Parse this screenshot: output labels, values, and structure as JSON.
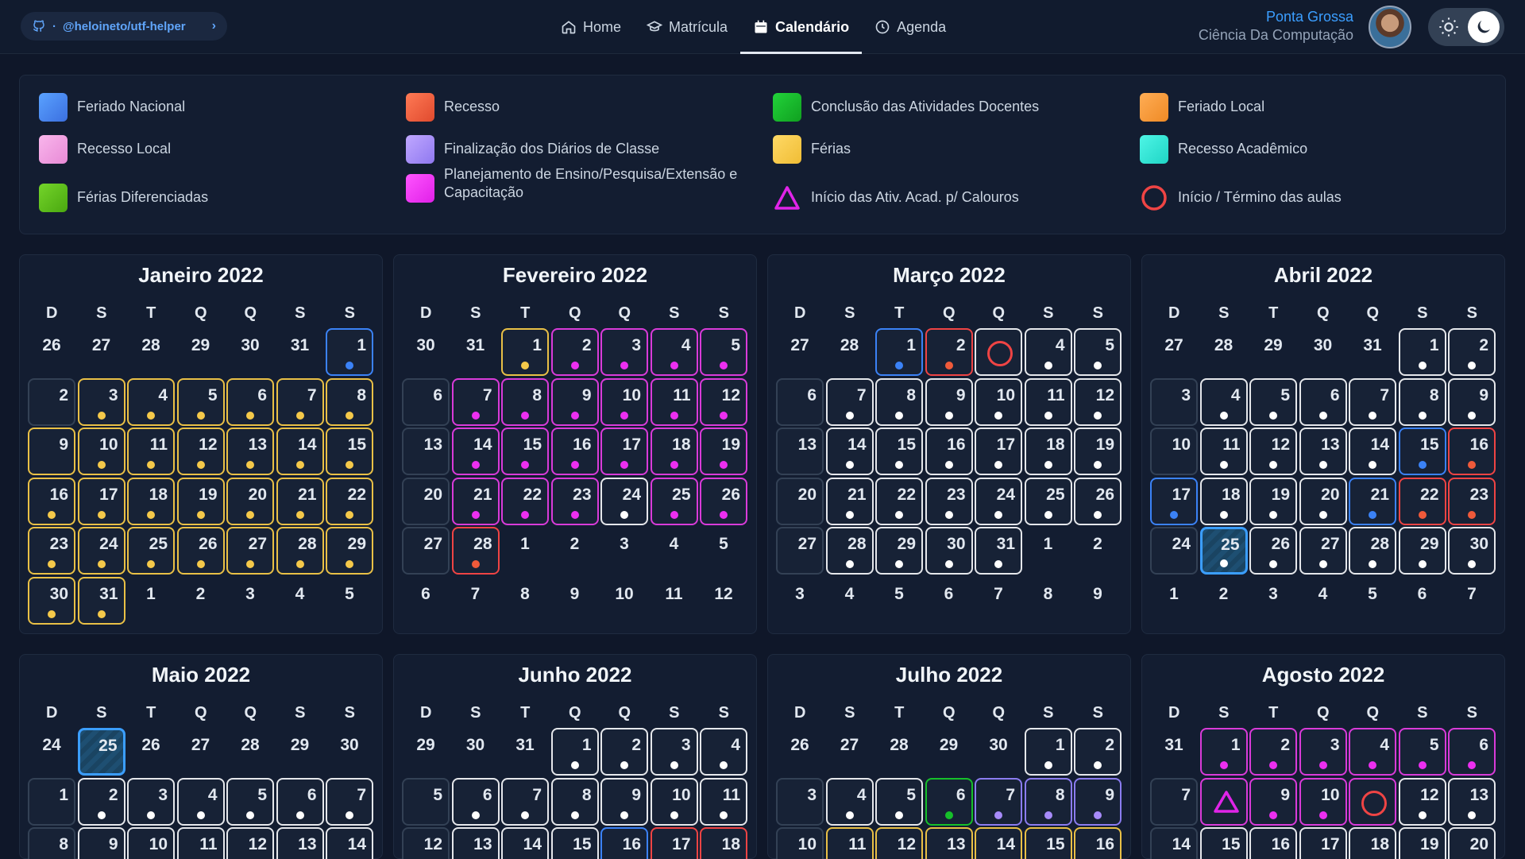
{
  "header": {
    "repo": "@heloineto/utf-helper",
    "nav": [
      {
        "label": "Home",
        "icon": "home-icon"
      },
      {
        "label": "Matrícula",
        "icon": "graduation-cap-icon"
      },
      {
        "label": "Calendário",
        "icon": "calendar-icon",
        "active": true
      },
      {
        "label": "Agenda",
        "icon": "clock-icon"
      }
    ],
    "user_city": "Ponta Grossa",
    "user_course": "Ciência Da Computação"
  },
  "legend": [
    {
      "label": "Feriado Nacional",
      "color": "#3b82f6"
    },
    {
      "label": "Recesso",
      "color": "#f05a3a"
    },
    {
      "label": "Conclusão das Atividades Docentes",
      "color": "#16c02a"
    },
    {
      "label": "Feriado Local",
      "color": "#f5962f"
    },
    {
      "label": "Recesso Local",
      "color": "#f0a0e0"
    },
    {
      "label": "Finalização dos Diários de Classe",
      "color": "#a78bfa"
    },
    {
      "label": "Férias",
      "color": "#f5c94a"
    },
    {
      "label": "Recesso Acadêmico",
      "color": "#2ee6d6"
    },
    {
      "label": "Férias Diferenciadas",
      "color": "#5fc01a"
    },
    {
      "label": "Planejamento de Ensino/Pesquisa/Extensão e Capacitação",
      "color": "#ec2ff0"
    },
    {
      "label": "Início das Ativ. Acad. p/ Calouros",
      "icon": "triangle-icon"
    },
    {
      "label": "Início / Término das aulas",
      "icon": "circle-icon"
    }
  ],
  "weekdays": [
    "D",
    "S",
    "T",
    "Q",
    "Q",
    "S",
    "S"
  ],
  "months": [
    {
      "title": "Janeiro 2022",
      "rows": [
        [
          "o26",
          "o27",
          "o28",
          "o29",
          "o30",
          "o31",
          "1:B:N"
        ],
        [
          "2:Z",
          "3:Y:F",
          "4:Y:F",
          "5:Y:F",
          "6:Y:F",
          "7:Y:F",
          "8:Y:F"
        ],
        [
          "9:Y",
          "10:Y:F",
          "11:Y:F",
          "12:Y:F",
          "13:Y:F",
          "14:Y:F",
          "15:Y:F"
        ],
        [
          "16:Y:F",
          "17:Y:F",
          "18:Y:F",
          "19:Y:F",
          "20:Y:F",
          "21:Y:F",
          "22:Y:F"
        ],
        [
          "23:Y:F",
          "24:Y:F",
          "25:Y:F",
          "26:Y:F",
          "27:Y:F",
          "28:Y:F",
          "29:Y:F"
        ],
        [
          "30:Y:F",
          "31:Y:F",
          "o1",
          "o2",
          "o3",
          "o4",
          "o5"
        ]
      ]
    },
    {
      "title": "Fevereiro 2022",
      "rows": [
        [
          "o30",
          "o31",
          "1:Y:F",
          "2:M:P",
          "3:M:P",
          "4:M:P",
          "5:M:P"
        ],
        [
          "6:Z",
          "7:M:P",
          "8:M:P",
          "9:M:P",
          "10:M:P",
          "11:M:P",
          "12:M:P"
        ],
        [
          "13:Z",
          "14:M:P",
          "15:M:P",
          "16:M:P",
          "17:M:P",
          "18:M:P",
          "19:M:P"
        ],
        [
          "20:Z",
          "21:M:P",
          "22:M:P",
          "23:M:P",
          "24:W:W",
          "25:M:P",
          "26:M:P"
        ],
        [
          "27:Z",
          "28:R:R",
          "o1",
          "o2",
          "o3",
          "o4",
          "o5"
        ],
        [
          "o6",
          "o7",
          "o8",
          "o9",
          "o10",
          "o11",
          "o12"
        ]
      ]
    },
    {
      "title": "Março 2022",
      "rows": [
        [
          "o27",
          "o28",
          "1:B:N",
          "2:R:R",
          "RING",
          "4:W:W",
          "5:W:W"
        ],
        [
          "6:Z",
          "7:W:W",
          "8:W:W",
          "9:W:W",
          "10:W:W",
          "11:W:W",
          "12:W:W"
        ],
        [
          "13:Z",
          "14:W:W",
          "15:W:W",
          "16:W:W",
          "17:W:W",
          "18:W:W",
          "19:W:W"
        ],
        [
          "20:Z",
          "21:W:W",
          "22:W:W",
          "23:W:W",
          "24:W:W",
          "25:W:W",
          "26:W:W"
        ],
        [
          "27:Z",
          "28:W:W",
          "29:W:W",
          "30:W:W",
          "31:W:W",
          "o1",
          "o2"
        ],
        [
          "o3",
          "o4",
          "o5",
          "o6",
          "o7",
          "o8",
          "o9"
        ]
      ]
    },
    {
      "title": "Abril 2022",
      "rows": [
        [
          "o27",
          "o28",
          "o29",
          "o30",
          "o31",
          "1:W:W",
          "2:W:W"
        ],
        [
          "3:Z",
          "4:W:W",
          "5:W:W",
          "6:W:W",
          "7:W:W",
          "8:W:W",
          "9:W:W"
        ],
        [
          "10:Z",
          "11:W:W",
          "12:W:W",
          "13:W:W",
          "14:W:W",
          "15:B:N",
          "16:R:R"
        ],
        [
          "17:B:N",
          "18:W:W",
          "19:W:W",
          "20:W:W",
          "21:B:N",
          "22:R:R",
          "23:R:R"
        ],
        [
          "24:Z",
          "TODAY25",
          "26:W:W",
          "27:W:W",
          "28:W:W",
          "29:W:W",
          "30:W:W"
        ],
        [
          "o1",
          "o2",
          "o3",
          "o4",
          "o5",
          "o6",
          "o7"
        ]
      ]
    },
    {
      "title": "Maio 2022",
      "rows": [
        [
          "o24",
          "TODAYE25",
          "o26",
          "o27",
          "o28",
          "o29",
          "o30"
        ],
        [
          "1:Z",
          "2:W:W",
          "3:W:W",
          "4:W:W",
          "5:W:W",
          "6:W:W",
          "7:W:W"
        ],
        [
          "8:Z",
          "9:W",
          "10:W",
          "11:W",
          "12:W",
          "13:W",
          "14:W"
        ]
      ]
    },
    {
      "title": "Junho 2022",
      "rows": [
        [
          "o29",
          "o30",
          "o31",
          "1:W:W",
          "2:W:W",
          "3:W:W",
          "4:W:W"
        ],
        [
          "5:Z",
          "6:W:W",
          "7:W:W",
          "8:W:W",
          "9:W:W",
          "10:W:W",
          "11:W:W"
        ],
        [
          "12:Z",
          "13:W",
          "14:W",
          "15:W",
          "16:B",
          "17:R",
          "18:R"
        ]
      ]
    },
    {
      "title": "Julho 2022",
      "rows": [
        [
          "o26",
          "o27",
          "o28",
          "o29",
          "o30",
          "1:W:W",
          "2:W:W"
        ],
        [
          "3:Z",
          "4:W:W",
          "5:W:W",
          "6:G:G",
          "7:V:V",
          "8:V:V",
          "9:V:V"
        ],
        [
          "10:Z",
          "11:Y",
          "12:Y",
          "13:Y",
          "14:Y",
          "15:Y",
          "16:Y"
        ]
      ]
    },
    {
      "title": "Agosto 2022",
      "rows": [
        [
          "o31",
          "1:M:P",
          "2:M:P",
          "3:M:P",
          "4:M:P",
          "5:M:P",
          "6:M:P"
        ],
        [
          "7:Z",
          "TRI",
          "9:M:P",
          "10:M:P",
          "RING",
          "12:W:W",
          "13:W:W"
        ],
        [
          "14:Z",
          "15:W",
          "16:W",
          "17:W",
          "18:W",
          "19:W",
          "20:W"
        ]
      ]
    }
  ]
}
